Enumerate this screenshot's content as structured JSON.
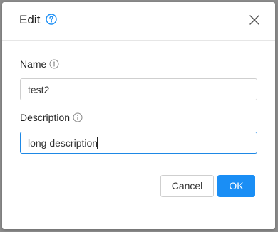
{
  "dialog": {
    "title": "Edit",
    "icons": {
      "help": "help-circle-icon",
      "close": "close-icon",
      "info": "info-circle-icon"
    },
    "colors": {
      "accent": "#1a8ef5",
      "focus_border": "#1e88e5",
      "backdrop": "#8d8d8d"
    }
  },
  "form": {
    "name": {
      "label": "Name",
      "value": "test2"
    },
    "description": {
      "label": "Description",
      "value": "long description"
    }
  },
  "footer": {
    "cancel_label": "Cancel",
    "ok_label": "OK"
  }
}
